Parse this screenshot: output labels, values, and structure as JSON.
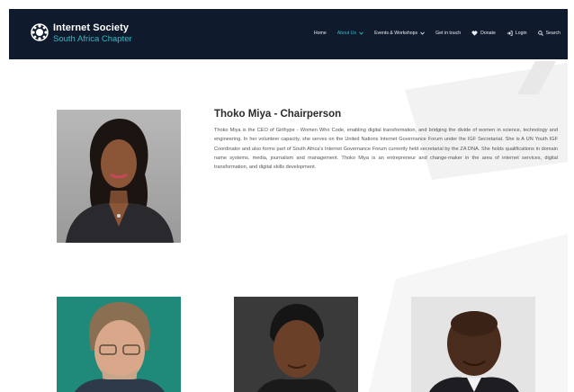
{
  "header": {
    "brand_name": "Internet Society",
    "brand_subtitle": "South Africa Chapter",
    "logo_icon": "internet-society-globe-icon",
    "nav": [
      {
        "label": "Home",
        "active": false,
        "dropdown": false
      },
      {
        "label": "About Us",
        "active": true,
        "dropdown": true
      },
      {
        "label": "Events & Workshops",
        "active": false,
        "dropdown": true
      },
      {
        "label": "Get in touch",
        "active": false,
        "dropdown": false
      },
      {
        "label": "Donate",
        "active": false,
        "dropdown": false,
        "icon": "heart-icon"
      },
      {
        "label": "Login",
        "active": false,
        "dropdown": false,
        "icon": "login-icon"
      },
      {
        "label": "Search",
        "active": false,
        "dropdown": false,
        "icon": "search-icon"
      }
    ]
  },
  "featured": {
    "title": "Thoko Miya - Chairperson",
    "bio": "Thoko Miya is the CEO of Girlhype - Women Who Code, enabling digital transformation, and bridging the divide of women in science, technology and engineering. In her volunteer capacity, she serves on the United Nations Internet Governance Forum under the IGF Secretariat. She is A UN Youth IGF Coordinator and also forms part of South Africa's Internet Governance Forum currently held secretarial by the ZA DNA. She holds qualifications in domain name systems, media, journalism and management. Thoko Miya is an entrepreneur and change-maker in the area of internet services, digital transformation, and digital skills development."
  },
  "colors": {
    "header_bg": "#0f1b2d",
    "accent": "#37b7c4",
    "text": "#2a2a2a",
    "body_text": "#555555"
  }
}
